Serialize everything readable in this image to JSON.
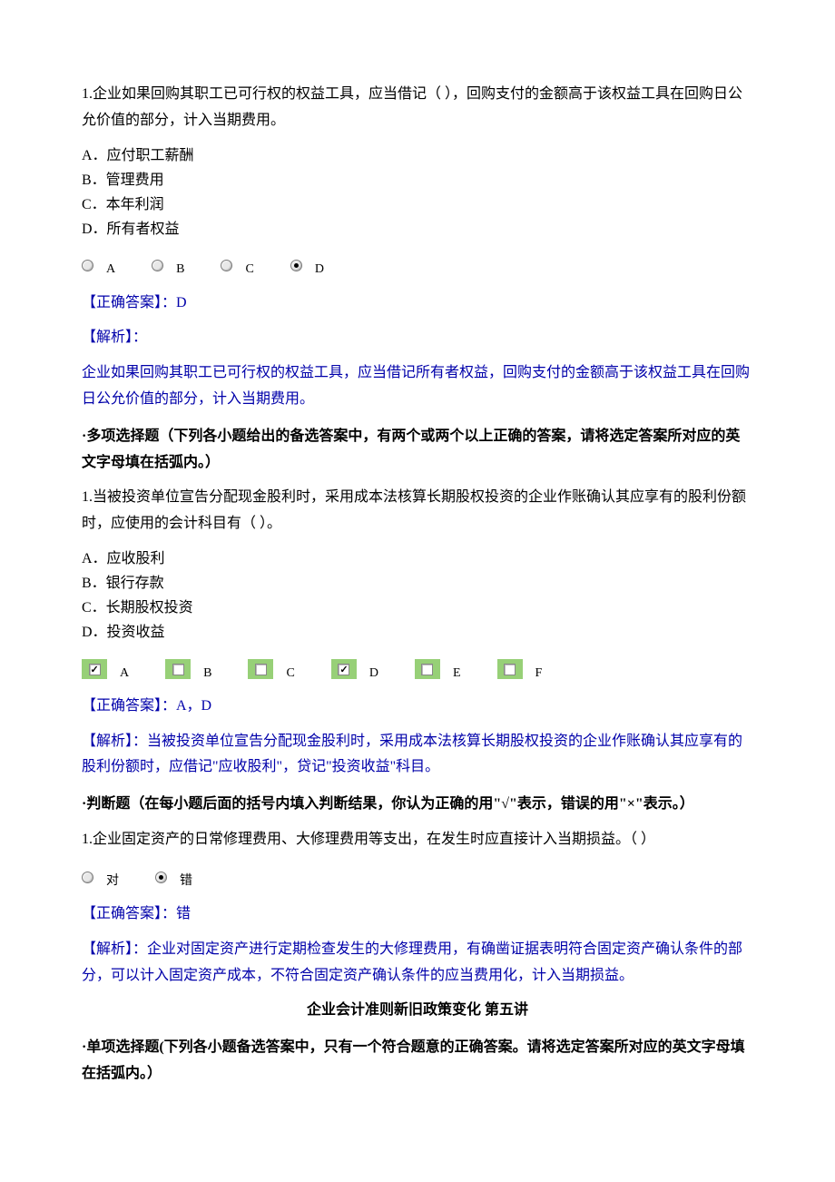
{
  "q1": {
    "text": "1.企业如果回购其职工已可行权的权益工具，应当借记（ ），回购支付的金额高于该权益工具在回购日公允价值的部分，计入当期费用。",
    "opts": {
      "a": "A．应付职工薪酬",
      "b": "B．管理费用",
      "c": "C．本年利润",
      "d": "D．所有者权益"
    },
    "labels": {
      "a": "A",
      "b": "B",
      "c": "C",
      "d": "D"
    },
    "answer": "【正确答案】：D",
    "analysis_label": "【解析】：",
    "analysis": "企业如果回购其职工已可行权的权益工具，应当借记所有者权益，回购支付的金额高于该权益工具在回购日公允价值的部分，计入当期费用。"
  },
  "multi_header": "·多项选择题（下列各小题给出的备选答案中，有两个或两个以上正确的答案，请将选定答案所对应的英文字母填在括弧内。）",
  "q2": {
    "text": "1.当被投资单位宣告分配现金股利时，采用成本法核算长期股权投资的企业作账确认其应享有的股利份额时，应使用的会计科目有（ ）。",
    "opts": {
      "a": "A．应收股利",
      "b": "B．银行存款",
      "c": "C．长期股权投资",
      "d": "D．投资收益"
    },
    "labels": {
      "a": "A",
      "b": "B",
      "c": "C",
      "d": "D",
      "e": "E",
      "f": "F"
    },
    "answer": "【正确答案】：A，D",
    "analysis": "【解析】：当被投资单位宣告分配现金股利时，采用成本法核算长期股权投资的企业作账确认其应享有的股利份额时，应借记\"应收股利\"，贷记\"投资收益\"科目。"
  },
  "judge_header": "·判断题（在每小题后面的括号内填入判断结果，你认为正确的用\"√\"表示，错误的用\"×\"表示。）",
  "q3": {
    "text": "1.企业固定资产的日常修理费用、大修理费用等支出，在发生时应直接计入当期损益。（ ）",
    "labels": {
      "t": "对",
      "f": "错"
    },
    "answer": "【正确答案】：错",
    "analysis": "【解析】：企业对固定资产进行定期检查发生的大修理费用，有确凿证据表明符合固定资产确认条件的部分，可以计入固定资产成本，不符合固定资产确认条件的应当费用化，计入当期损益。"
  },
  "lecture_title": "企业会计准则新旧政策变化  第五讲",
  "single_header": "·单项选择题(下列各小题备选答案中，只有一个符合题意的正确答案。请将选定答案所对应的英文字母填在括弧内。）"
}
